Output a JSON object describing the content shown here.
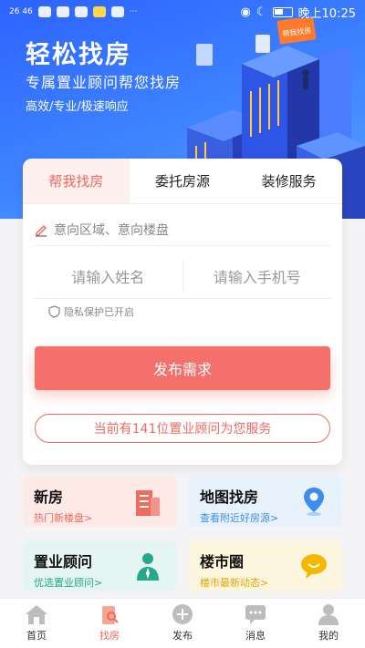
{
  "status_bar": {
    "network": "26 46",
    "time": "晚上10:25"
  },
  "hero": {
    "title": "轻松找房",
    "subtitle": "专属置业顾问帮您找房",
    "tags": "高效/专业/极速响应",
    "sign_text": "帮我找房"
  },
  "tabs": [
    {
      "label": "帮我找房",
      "active": true
    },
    {
      "label": "委托房源",
      "active": false
    },
    {
      "label": "装修服务",
      "active": false
    }
  ],
  "form": {
    "region_placeholder": "意向区域、意向楼盘",
    "name_placeholder": "请输入姓名",
    "phone_placeholder": "请输入手机号",
    "privacy": "隐私保护已开启",
    "submit": "发布需求",
    "advisors": "当前有141位置业顾问为您服务"
  },
  "tiles": [
    {
      "title": "新房",
      "subtitle": "热门新楼盘>"
    },
    {
      "title": "地图找房",
      "subtitle": "查看附近好房源>"
    },
    {
      "title": "置业顾问",
      "subtitle": "优选置业顾问>"
    },
    {
      "title": "楼市圈",
      "subtitle": "楼市最新动态>"
    }
  ],
  "bottom_nav": [
    {
      "label": "首页",
      "active": false
    },
    {
      "label": "找房",
      "active": true
    },
    {
      "label": "发布",
      "active": false
    },
    {
      "label": "消息",
      "active": false
    },
    {
      "label": "我的",
      "active": false
    }
  ],
  "colors": {
    "primary": "#f56f6b",
    "hero_blue": "#3e84ff"
  }
}
